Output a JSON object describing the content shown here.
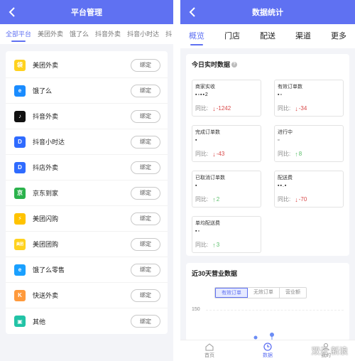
{
  "left": {
    "title": "平台管理",
    "tabs": [
      "全部平台",
      "美团外卖",
      "饿了么",
      "抖音外卖",
      "抖音小时达",
      "抖"
    ],
    "bind_label": "绑定",
    "platforms": [
      {
        "name": "美团外卖",
        "icon": "meituan-waimai-icon",
        "color": "#ffd21e",
        "glyph": "袋"
      },
      {
        "name": "饿了么",
        "icon": "eleme-icon",
        "color": "#1a8cff",
        "glyph": "e"
      },
      {
        "name": "抖音外卖",
        "icon": "douyin-icon",
        "color": "#111111",
        "glyph": "♪"
      },
      {
        "name": "抖音小时达",
        "icon": "douyin-hour-icon",
        "color": "#2f6bff",
        "glyph": "D"
      },
      {
        "name": "抖店外卖",
        "icon": "douyin-shop-icon",
        "color": "#2f6bff",
        "glyph": "D"
      },
      {
        "name": "京东到家",
        "icon": "jd-daojia-icon",
        "color": "#2bb24c",
        "glyph": "京"
      },
      {
        "name": "美团闪购",
        "icon": "meituan-shangou-icon",
        "color": "#ffc300",
        "glyph": "⚡"
      },
      {
        "name": "美团团购",
        "icon": "meituan-tuangou-icon",
        "color": "#ffd21e",
        "glyph": "美团"
      },
      {
        "name": "饿了么零售",
        "icon": "eleme-retail-icon",
        "color": "#1aa0ff",
        "glyph": "e"
      },
      {
        "name": "快送外卖",
        "icon": "kuaisong-icon",
        "color": "#ff9a3c",
        "glyph": "K"
      },
      {
        "name": "其他",
        "icon": "other-cube-icon",
        "color": "#22c3a6",
        "glyph": "▣"
      }
    ]
  },
  "right": {
    "title": "数据统计",
    "tabs": [
      "概览",
      "门店",
      "配送",
      "渠道",
      "更多"
    ],
    "realtime_title": "今日实时数据",
    "metrics": [
      {
        "label": "商家实收",
        "value": "▪▫▪▪2",
        "cmp_label": "同比:",
        "arrow": "↓",
        "dir": "down",
        "change": "-1242"
      },
      {
        "label": "有效订单数",
        "value": "▪▫",
        "cmp_label": "同比:",
        "arrow": "↓",
        "dir": "down",
        "change": "-34"
      },
      {
        "label": "完成订单数",
        "value": "▪",
        "cmp_label": "同比:",
        "arrow": "↓",
        "dir": "down",
        "change": "-43"
      },
      {
        "label": "进行中",
        "value": "▫",
        "cmp_label": "同比:",
        "arrow": "↑",
        "dir": "up",
        "change": "8"
      },
      {
        "label": "已取消订单数",
        "value": "▪",
        "cmp_label": "同比:",
        "arrow": "↑",
        "dir": "up",
        "change": "2"
      },
      {
        "label": "配送费",
        "value": "▪▪.▪",
        "cmp_label": "同比:",
        "arrow": "↓",
        "dir": "down",
        "change": "-70"
      },
      {
        "label": "单均配送费",
        "value": "▪▫",
        "cmp_label": "同比:",
        "arrow": "↑",
        "dir": "up",
        "change": "3"
      }
    ],
    "trend_title": "近30天营业数据",
    "segments": [
      "有效订单",
      "无效订单",
      "营业额"
    ],
    "y_tick": "150",
    "nav": [
      {
        "label": "首页",
        "icon": "home-icon"
      },
      {
        "label": "数据",
        "icon": "data-clock-icon"
      },
      {
        "label": "我的",
        "icon": "user-icon"
      }
    ],
    "watermark": "双云 新浪"
  }
}
